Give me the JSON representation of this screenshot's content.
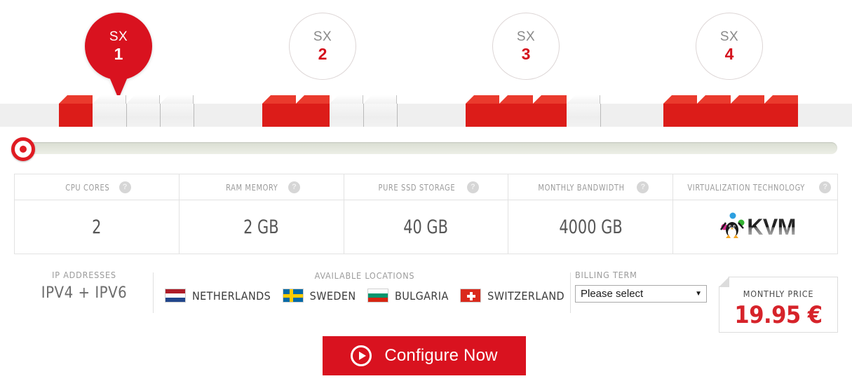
{
  "plans": [
    {
      "prefix": "SX",
      "number": "1",
      "active": true,
      "filled": 1
    },
    {
      "prefix": "SX",
      "number": "2",
      "active": false,
      "filled": 2
    },
    {
      "prefix": "SX",
      "number": "3",
      "active": false,
      "filled": 3
    },
    {
      "prefix": "SX",
      "number": "4",
      "active": false,
      "filled": 4
    }
  ],
  "slider": {
    "handle_label": "slider-handle",
    "position_percent": 0
  },
  "specs": {
    "headers": [
      "CPU CORES",
      "RAM MEMORY",
      "PURE SSD STORAGE",
      "MONTHLY BANDWIDTH",
      "VIRTUALIZATION TECHNOLOGY"
    ],
    "help_glyph": "?",
    "values": [
      "2",
      "2 GB",
      "40 GB",
      "4000 GB",
      "KVM"
    ]
  },
  "ip": {
    "label": "IP ADDRESSES",
    "value": "IPV4 + IPV6"
  },
  "locations": {
    "label": "AVAILABLE LOCATIONS",
    "items": [
      {
        "name": "NETHERLANDS",
        "flag": "flag-nl"
      },
      {
        "name": "SWEDEN",
        "flag": "flag-se"
      },
      {
        "name": "BULGARIA",
        "flag": "flag-bg"
      },
      {
        "name": "SWITZERLAND",
        "flag": "flag-ch"
      }
    ]
  },
  "billing": {
    "label": "BILLING TERM",
    "selected": "Please select",
    "caret": "▼"
  },
  "price": {
    "label": "MONTHLY PRICE",
    "value": "19.95 €"
  },
  "cta": {
    "label": "Configure Now"
  },
  "colors": {
    "brand_red": "#d9121f",
    "price_red": "#d6232a",
    "muted": "#9b9b9b"
  }
}
